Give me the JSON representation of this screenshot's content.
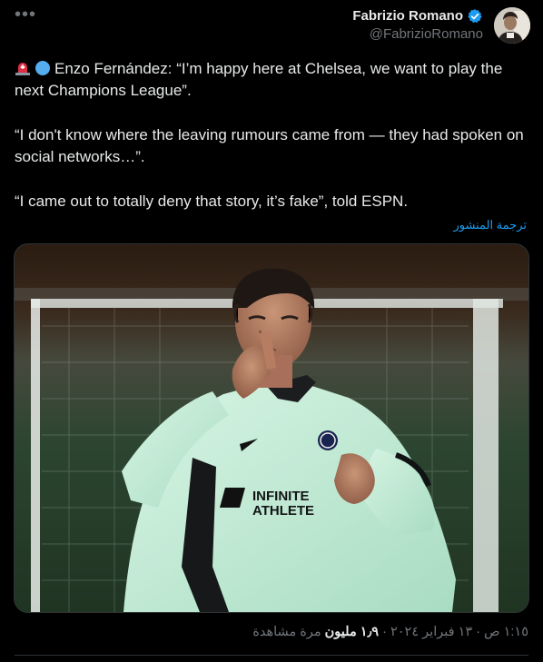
{
  "header": {
    "more_icon": "more-horizontal-icon",
    "display_name": "Fabrizio Romano",
    "handle": "@FabrizioRomano",
    "verified_color": "#1d9bf0"
  },
  "tweet": {
    "line1": "Enzo Fernández: “I’m happy here at Chelsea, we want to play the next Champions League”.",
    "line2": "“I don't know where the leaving rumours came from — they had spoken on social networks…”.",
    "line3": "“I came out to totally deny that story, it’s fake”, told ESPN.",
    "emojis": [
      "siren-emoji",
      "blue-circle-emoji"
    ]
  },
  "translate_label": "ترجمة المنشور",
  "media": {
    "shirt_text_line1": "INFINITE",
    "shirt_text_line2": "ATHLETE"
  },
  "meta": {
    "time": "١:١٥ ص",
    "date": "١٣ فبراير ٢٠٢٤",
    "views": "١٫٩ مليون",
    "views_label": "مرة مشاهدة"
  },
  "colors": {
    "background": "#000000",
    "text": "#e7e9ea",
    "muted": "#71767b",
    "link": "#1d9bf0",
    "jersey": "#c8efda"
  }
}
